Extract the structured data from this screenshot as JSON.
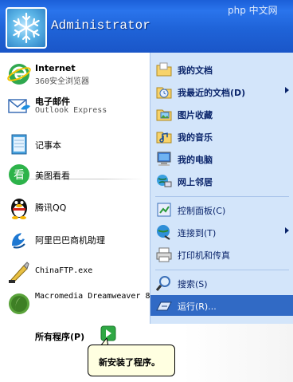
{
  "header": {
    "username": "Administrator",
    "watermark": "php 中文网"
  },
  "left": {
    "pinned": [
      {
        "title": "Internet",
        "subtitle": "360安全浏览器",
        "icon": "browser-icon"
      },
      {
        "title": "电子邮件",
        "subtitle": "Outlook Express",
        "icon": "email-icon"
      }
    ],
    "recent": [
      {
        "label": "记事本",
        "icon": "notepad-icon"
      },
      {
        "label": "美图看看",
        "icon": "image-viewer-icon"
      },
      {
        "label": "腾讯QQ",
        "icon": "qq-penguin-icon"
      },
      {
        "label": "阿里巴巴商机助理",
        "icon": "aliwangwang-icon"
      },
      {
        "label": "ChinaFTP.exe",
        "icon": "ftp-icon"
      },
      {
        "label": "Macromedia Dreamweaver 8",
        "icon": "dreamweaver-icon"
      }
    ],
    "all_programs": "所有程序(P)"
  },
  "right": {
    "items": [
      {
        "label": "我的文档",
        "bold": true,
        "icon": "my-documents-icon"
      },
      {
        "label": "我最近的文档(D)",
        "bold": true,
        "icon": "recent-documents-icon",
        "submenu": true
      },
      {
        "label": "图片收藏",
        "bold": true,
        "icon": "my-pictures-icon"
      },
      {
        "label": "我的音乐",
        "bold": true,
        "icon": "my-music-icon"
      },
      {
        "label": "我的电脑",
        "bold": true,
        "icon": "my-computer-icon"
      },
      {
        "label": "网上邻居",
        "bold": true,
        "icon": "network-icon"
      },
      {
        "label": "控制面板(C)",
        "bold": false,
        "icon": "control-panel-icon"
      },
      {
        "label": "连接到(T)",
        "bold": false,
        "icon": "connect-to-icon",
        "submenu": true
      },
      {
        "label": "打印机和传真",
        "bold": false,
        "icon": "printer-icon"
      },
      {
        "label": "搜索(S)",
        "bold": false,
        "icon": "search-icon"
      },
      {
        "label": "运行(R)...",
        "bold": false,
        "icon": "run-icon",
        "selected": true
      }
    ]
  },
  "balloon": {
    "text": "新安装了程序。"
  },
  "colors": {
    "header_blue": "#1f63d8",
    "right_pane": "#d3e5fa",
    "selection": "#316ac5",
    "accent_orange": "#e8822b"
  }
}
